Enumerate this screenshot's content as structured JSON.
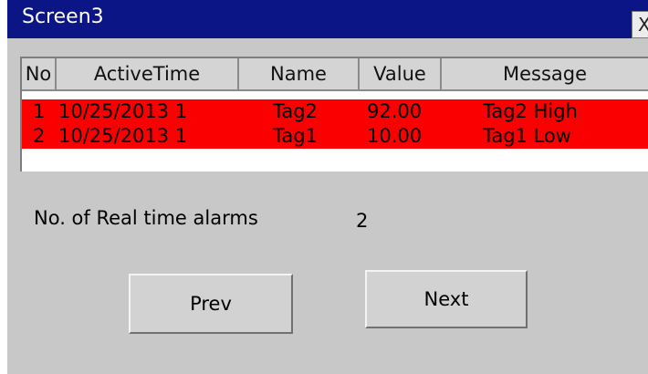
{
  "window": {
    "title": "Screen3",
    "close_label": "X"
  },
  "table": {
    "columns": [
      "No",
      "ActiveTime",
      "Name",
      "Value",
      "Message"
    ],
    "rows": [
      {
        "no": "1",
        "active_time": "10/25/2013 1",
        "name": "Tag2",
        "value": "92.00",
        "message": "Tag2 High"
      },
      {
        "no": "2",
        "active_time": "10/25/2013 1",
        "name": "Tag1",
        "value": "10.00",
        "message": "Tag1 Low"
      }
    ],
    "row_color": "#fb0000"
  },
  "summary": {
    "label": "No. of Real time alarms",
    "count": "2"
  },
  "buttons": {
    "prev": "Prev",
    "next": "Next"
  },
  "colors": {
    "titlebar": "#0c1585",
    "panel": "#c8c8c8"
  }
}
